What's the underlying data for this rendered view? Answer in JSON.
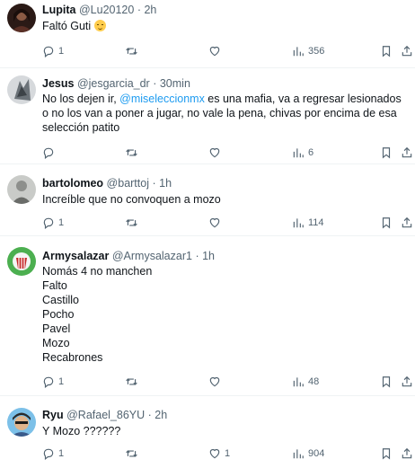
{
  "tweets": [
    {
      "name": "Lupita",
      "handle": "@Lu20120",
      "time": "2h",
      "lines": [
        "Faltó Guti"
      ],
      "replies": "1",
      "retweets": "",
      "likes": "",
      "views": "356"
    },
    {
      "name": "Jesus",
      "handle": "@jesgarcia_dr",
      "time": "30min",
      "text_before": "No los dejen ir, ",
      "mention": "@miseleccionmx",
      "text_after": " es una mafia, va a regresar lesionados o no los van a poner a jugar, no vale la pena, chivas por encima de esa selección patito",
      "replies": "",
      "retweets": "",
      "likes": "",
      "views": "6"
    },
    {
      "name": "bartolomeo",
      "handle": "@barttoj",
      "time": "1h",
      "lines": [
        "Increíble que no convoquen a mozo"
      ],
      "replies": "1",
      "retweets": "",
      "likes": "",
      "views": "114"
    },
    {
      "name": "Armysalazar",
      "handle": "@Armysalazar1",
      "time": "1h",
      "lines": [
        "Nomás 4 no manchen",
        "Falto",
        "Castillo",
        "Pocho",
        "Pavel",
        "Mozo",
        "Recabrones"
      ],
      "replies": "1",
      "retweets": "",
      "likes": "",
      "views": "48"
    },
    {
      "name": "Ryu",
      "handle": "@Rafael_86YU",
      "time": "2h",
      "lines": [
        "Y Mozo ??????"
      ],
      "replies": "1",
      "retweets": "",
      "likes": "1",
      "views": "904"
    }
  ],
  "separator": "·",
  "icons": {
    "reply": "reply-icon",
    "retweet": "retweet-icon",
    "like": "heart-icon",
    "views": "views-chart-icon",
    "bookmark": "bookmark-icon",
    "share": "share-icon",
    "emoji": "sleepy-face-emoji"
  },
  "colors": {
    "text": "#0f1419",
    "secondary": "#536471",
    "mention": "#1d9bf0",
    "divider": "#eff3f4"
  }
}
